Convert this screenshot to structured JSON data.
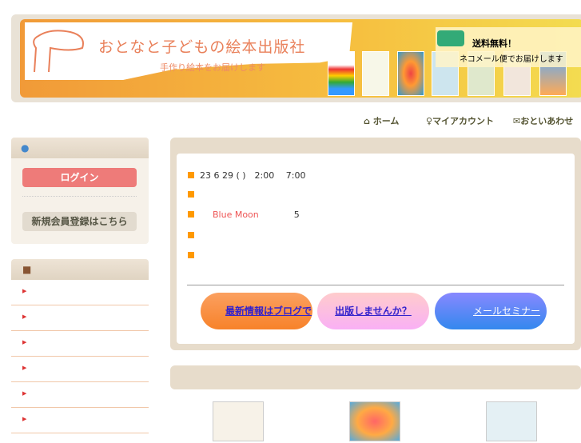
{
  "header": {
    "title": "おとなと子どもの絵本出版社",
    "subtitle": "手作り絵本をお届けします",
    "shipping_title": "送料無料！",
    "shipping_text": "ネコメール便でお届けします"
  },
  "nav": [
    {
      "label": "ホーム",
      "icon": "home-icon"
    },
    {
      "label": "マイアカウント",
      "icon": "user-icon"
    },
    {
      "label": "おといあわせ",
      "icon": "mail-icon"
    }
  ],
  "sidebar": {
    "login": "ログイン",
    "register": "新規会員登録はこちら",
    "category_markers": [
      "▶",
      "▶",
      "▶",
      "▶",
      "▶",
      "▶"
    ]
  },
  "news": [
    {
      "text": "23 6 29 ( )　2:00　 7:00"
    },
    {
      "text": ""
    },
    {
      "link": "Blue Moon",
      "text": "5"
    },
    {
      "text": ""
    },
    {
      "text": ""
    }
  ],
  "buttons": {
    "blog": "最新情報はブログで",
    "publish": "出版しませんか？",
    "seminar": "メールセミナー"
  }
}
